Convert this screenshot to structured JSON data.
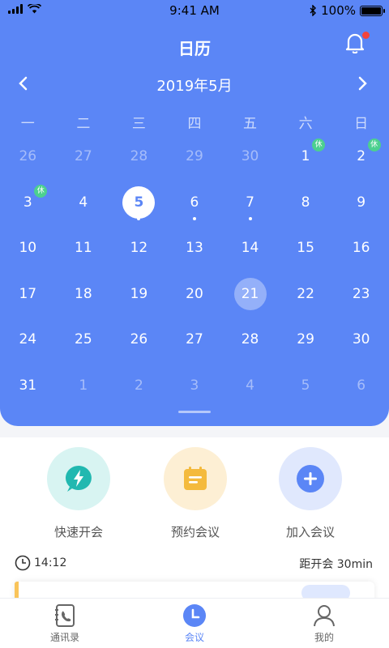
{
  "status": {
    "time": "9:41 AM",
    "battery": "100%"
  },
  "header": {
    "title": "日历"
  },
  "calendar": {
    "month_label": "2019年5月",
    "weekdays": [
      "一",
      "二",
      "三",
      "四",
      "五",
      "六",
      "日"
    ],
    "holiday_badge": "休",
    "weeks": [
      [
        {
          "d": "26",
          "muted": true
        },
        {
          "d": "27",
          "muted": true
        },
        {
          "d": "28",
          "muted": true
        },
        {
          "d": "29",
          "muted": true
        },
        {
          "d": "30",
          "muted": true
        },
        {
          "d": "1",
          "holiday": true
        },
        {
          "d": "2",
          "holiday": true
        }
      ],
      [
        {
          "d": "3",
          "holiday": true
        },
        {
          "d": "4"
        },
        {
          "d": "5",
          "today": true,
          "dot": true
        },
        {
          "d": "6",
          "dot": true
        },
        {
          "d": "7",
          "dot": true
        },
        {
          "d": "8"
        },
        {
          "d": "9"
        }
      ],
      [
        {
          "d": "10"
        },
        {
          "d": "11"
        },
        {
          "d": "12"
        },
        {
          "d": "13"
        },
        {
          "d": "14"
        },
        {
          "d": "15"
        },
        {
          "d": "16"
        }
      ],
      [
        {
          "d": "17"
        },
        {
          "d": "18"
        },
        {
          "d": "19"
        },
        {
          "d": "20"
        },
        {
          "d": "21",
          "selected": true
        },
        {
          "d": "22"
        },
        {
          "d": "23"
        }
      ],
      [
        {
          "d": "24"
        },
        {
          "d": "25"
        },
        {
          "d": "26"
        },
        {
          "d": "27"
        },
        {
          "d": "28"
        },
        {
          "d": "29"
        },
        {
          "d": "30"
        }
      ],
      [
        {
          "d": "31"
        },
        {
          "d": "1",
          "muted": true
        },
        {
          "d": "2",
          "muted": true
        },
        {
          "d": "3",
          "muted": true
        },
        {
          "d": "4",
          "muted": true
        },
        {
          "d": "5",
          "muted": true
        },
        {
          "d": "6",
          "muted": true
        }
      ]
    ]
  },
  "actions": {
    "quick": {
      "label": "快速开会",
      "color": "#21b8b0"
    },
    "schedule": {
      "label": "预约会议",
      "color": "#f4ba3d"
    },
    "join": {
      "label": "加入会议",
      "color": "#5b86f6"
    }
  },
  "meeting": {
    "time": "14:12",
    "countdown": "距开会 30min"
  },
  "tabs": [
    {
      "label": "通讯录",
      "icon": "contacts-icon"
    },
    {
      "label": "会议",
      "icon": "meeting-clock-icon",
      "active": true
    },
    {
      "label": "我的",
      "icon": "profile-icon"
    }
  ],
  "colors": {
    "primary": "#5b86f6",
    "holiday": "#4cd08f",
    "notify": "#f5433b"
  }
}
